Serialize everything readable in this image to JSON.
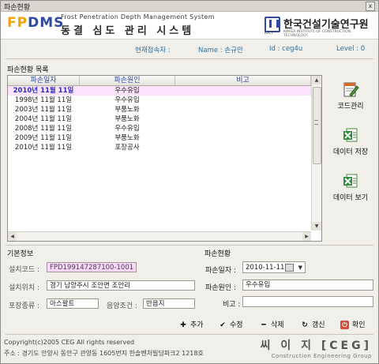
{
  "window": {
    "title": "파손현황",
    "close_label": "x"
  },
  "header": {
    "logo_fp": "FP",
    "logo_dms": "DMS",
    "subtitle_en": "Frost Penetration Depth Management System",
    "subtitle_ko": "동결 심도 관리 시스템",
    "org_code": "KICT",
    "org_name_ko": "한국건설기술연구원",
    "org_name_en": "KOREA INSTITUTE OF CONSTRUCTION TECHNOLOGY"
  },
  "userbar": {
    "current_user_label": "현재접속자 :",
    "name": "Name : 손규만",
    "id": "Id : ceg4u",
    "level": "Level : 0"
  },
  "damage_list": {
    "title": "파손현황 목록",
    "columns": [
      "파손일자",
      "파손원인",
      "비고"
    ],
    "rows": [
      {
        "date": "2010년 11월 11일",
        "cause": "우수유입",
        "note": "",
        "selected": true
      },
      {
        "date": "1998년 11월 11일",
        "cause": "우수유입",
        "note": ""
      },
      {
        "date": "2003년 11월 11일",
        "cause": "부품노화",
        "note": ""
      },
      {
        "date": "2004년 11월 11일",
        "cause": "부품노화",
        "note": ""
      },
      {
        "date": "2008년 11월 11일",
        "cause": "우수유입",
        "note": ""
      },
      {
        "date": "2009년 11월 11일",
        "cause": "부품노화",
        "note": ""
      },
      {
        "date": "2010년 11월 11일",
        "cause": "포장공사",
        "note": ""
      }
    ]
  },
  "side_actions": {
    "code_manage": "코드관리",
    "data_save": "데이터 저장",
    "data_view": "데이터 보기"
  },
  "basic_info": {
    "title": "기본정보",
    "install_code_label": "설치코드 :",
    "install_code": "FPD199147287100-1001",
    "install_location_label": "설치위치 :",
    "install_location": "경기 남양주시 조안면 조안리",
    "pavement_label": "포장종류 :",
    "pavement": "아스팔트",
    "sun_label": "음양조건 :",
    "sun": "반음지"
  },
  "damage_status": {
    "title": "파손현황",
    "date_label": "파손일자 :",
    "date_value": "2010-11-11",
    "cause_label": "파손원인 :",
    "cause_value": "우수유입",
    "note_label": "비고 :",
    "note_value": ""
  },
  "actions": {
    "add": "추가",
    "edit": "수정",
    "delete": "삭제",
    "refresh": "갱신",
    "confirm": "확인"
  },
  "footer": {
    "copyright": "Copyright(c)2005 CEG All rights reserved",
    "address": "주소 : 경기도 안양시 동안구 관양동 1605번지 한솔벤처빌딩파크2 1218호",
    "company_ko": "씨 이 지 [CEG]",
    "company_en": "Construction Engineering Group"
  },
  "colors": {
    "accent": "#2f4aa0",
    "selected_row": "#fbe3fb",
    "logo_orange": "#f0a500",
    "userbar_text": "#2e6f9e"
  }
}
